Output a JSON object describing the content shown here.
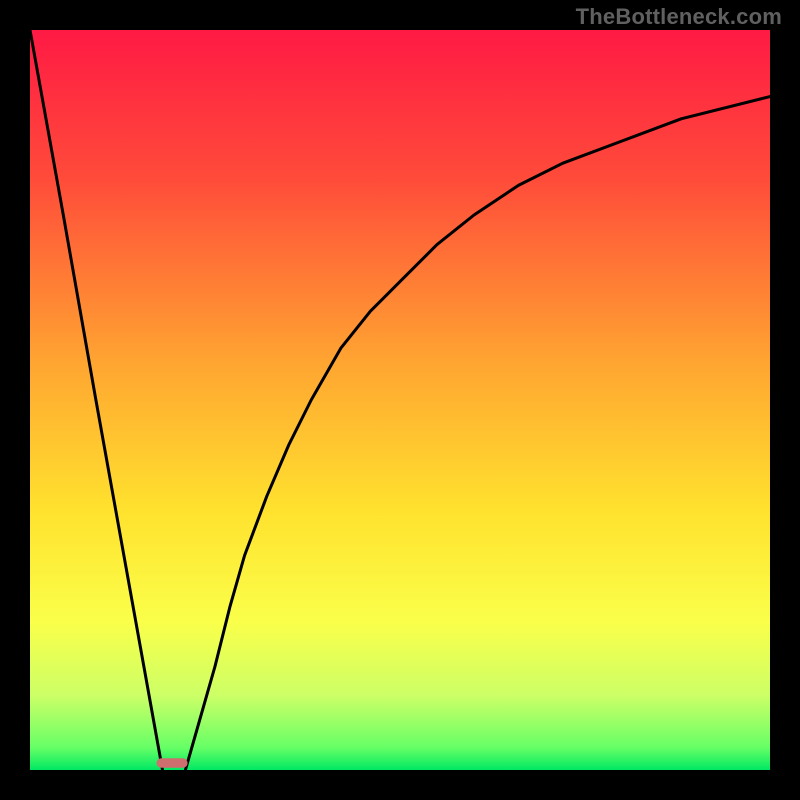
{
  "meta": {
    "watermark": "TheBottleneck.com"
  },
  "chart_data": {
    "type": "line",
    "title": "",
    "xlabel": "",
    "ylabel": "",
    "x_range": [
      0,
      100
    ],
    "y_range": [
      0,
      100
    ],
    "legend": false,
    "grid": false,
    "background_gradient_stops": [
      {
        "offset": 0.0,
        "color": "#ff1a44"
      },
      {
        "offset": 0.2,
        "color": "#ff4b3a"
      },
      {
        "offset": 0.45,
        "color": "#ffa531"
      },
      {
        "offset": 0.65,
        "color": "#ffe22e"
      },
      {
        "offset": 0.8,
        "color": "#faff4a"
      },
      {
        "offset": 0.9,
        "color": "#ccff66"
      },
      {
        "offset": 0.97,
        "color": "#66ff66"
      },
      {
        "offset": 1.0,
        "color": "#00e863"
      }
    ],
    "optimum_marker": {
      "x": 19.2,
      "y": 0.3,
      "width": 4.2,
      "height": 1.3,
      "color": "#cf6e6e"
    },
    "series": [
      {
        "name": "left-branch",
        "description": "steep descending line from top-left down to the optimum marker",
        "x": [
          0.0,
          4.5,
          8.9,
          13.4,
          17.9
        ],
        "y": [
          100.0,
          75.0,
          50.0,
          25.0,
          0.0
        ],
        "color": "#000000"
      },
      {
        "name": "right-branch",
        "description": "log-like rising curve from the optimum marker toward the upper right",
        "x": [
          21.0,
          23.0,
          25.0,
          27.0,
          29.0,
          32.0,
          35.0,
          38.0,
          42.0,
          46.0,
          50.0,
          55.0,
          60.0,
          66.0,
          72.0,
          80.0,
          88.0,
          100.0
        ],
        "y": [
          0.0,
          7.0,
          14.0,
          22.0,
          29.0,
          37.0,
          44.0,
          50.0,
          57.0,
          62.0,
          66.0,
          71.0,
          75.0,
          79.0,
          82.0,
          85.0,
          88.0,
          91.0
        ],
        "color": "#000000"
      }
    ]
  }
}
